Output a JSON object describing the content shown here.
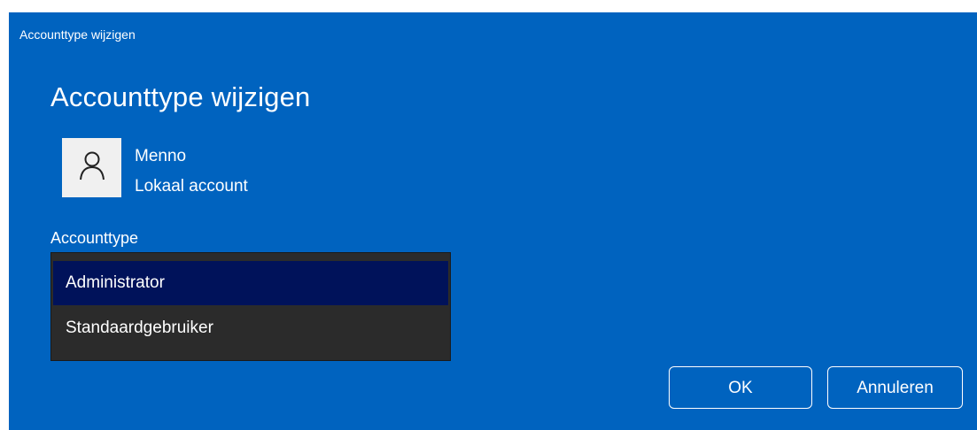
{
  "window": {
    "title": "Accounttype wijzigen"
  },
  "heading": "Accounttype wijzigen",
  "user": {
    "name": "Menno",
    "account_kind": "Lokaal account",
    "avatar_icon": "person-icon"
  },
  "account_type": {
    "label": "Accounttype",
    "options": [
      "Administrator",
      "Standaardgebruiker"
    ],
    "selected": "Administrator"
  },
  "buttons": {
    "ok": "OK",
    "cancel": "Annuleren"
  },
  "colors": {
    "dialog_background": "#0063bf",
    "selected_option": "#00125a",
    "listbox_background": "#2b2b2b"
  }
}
